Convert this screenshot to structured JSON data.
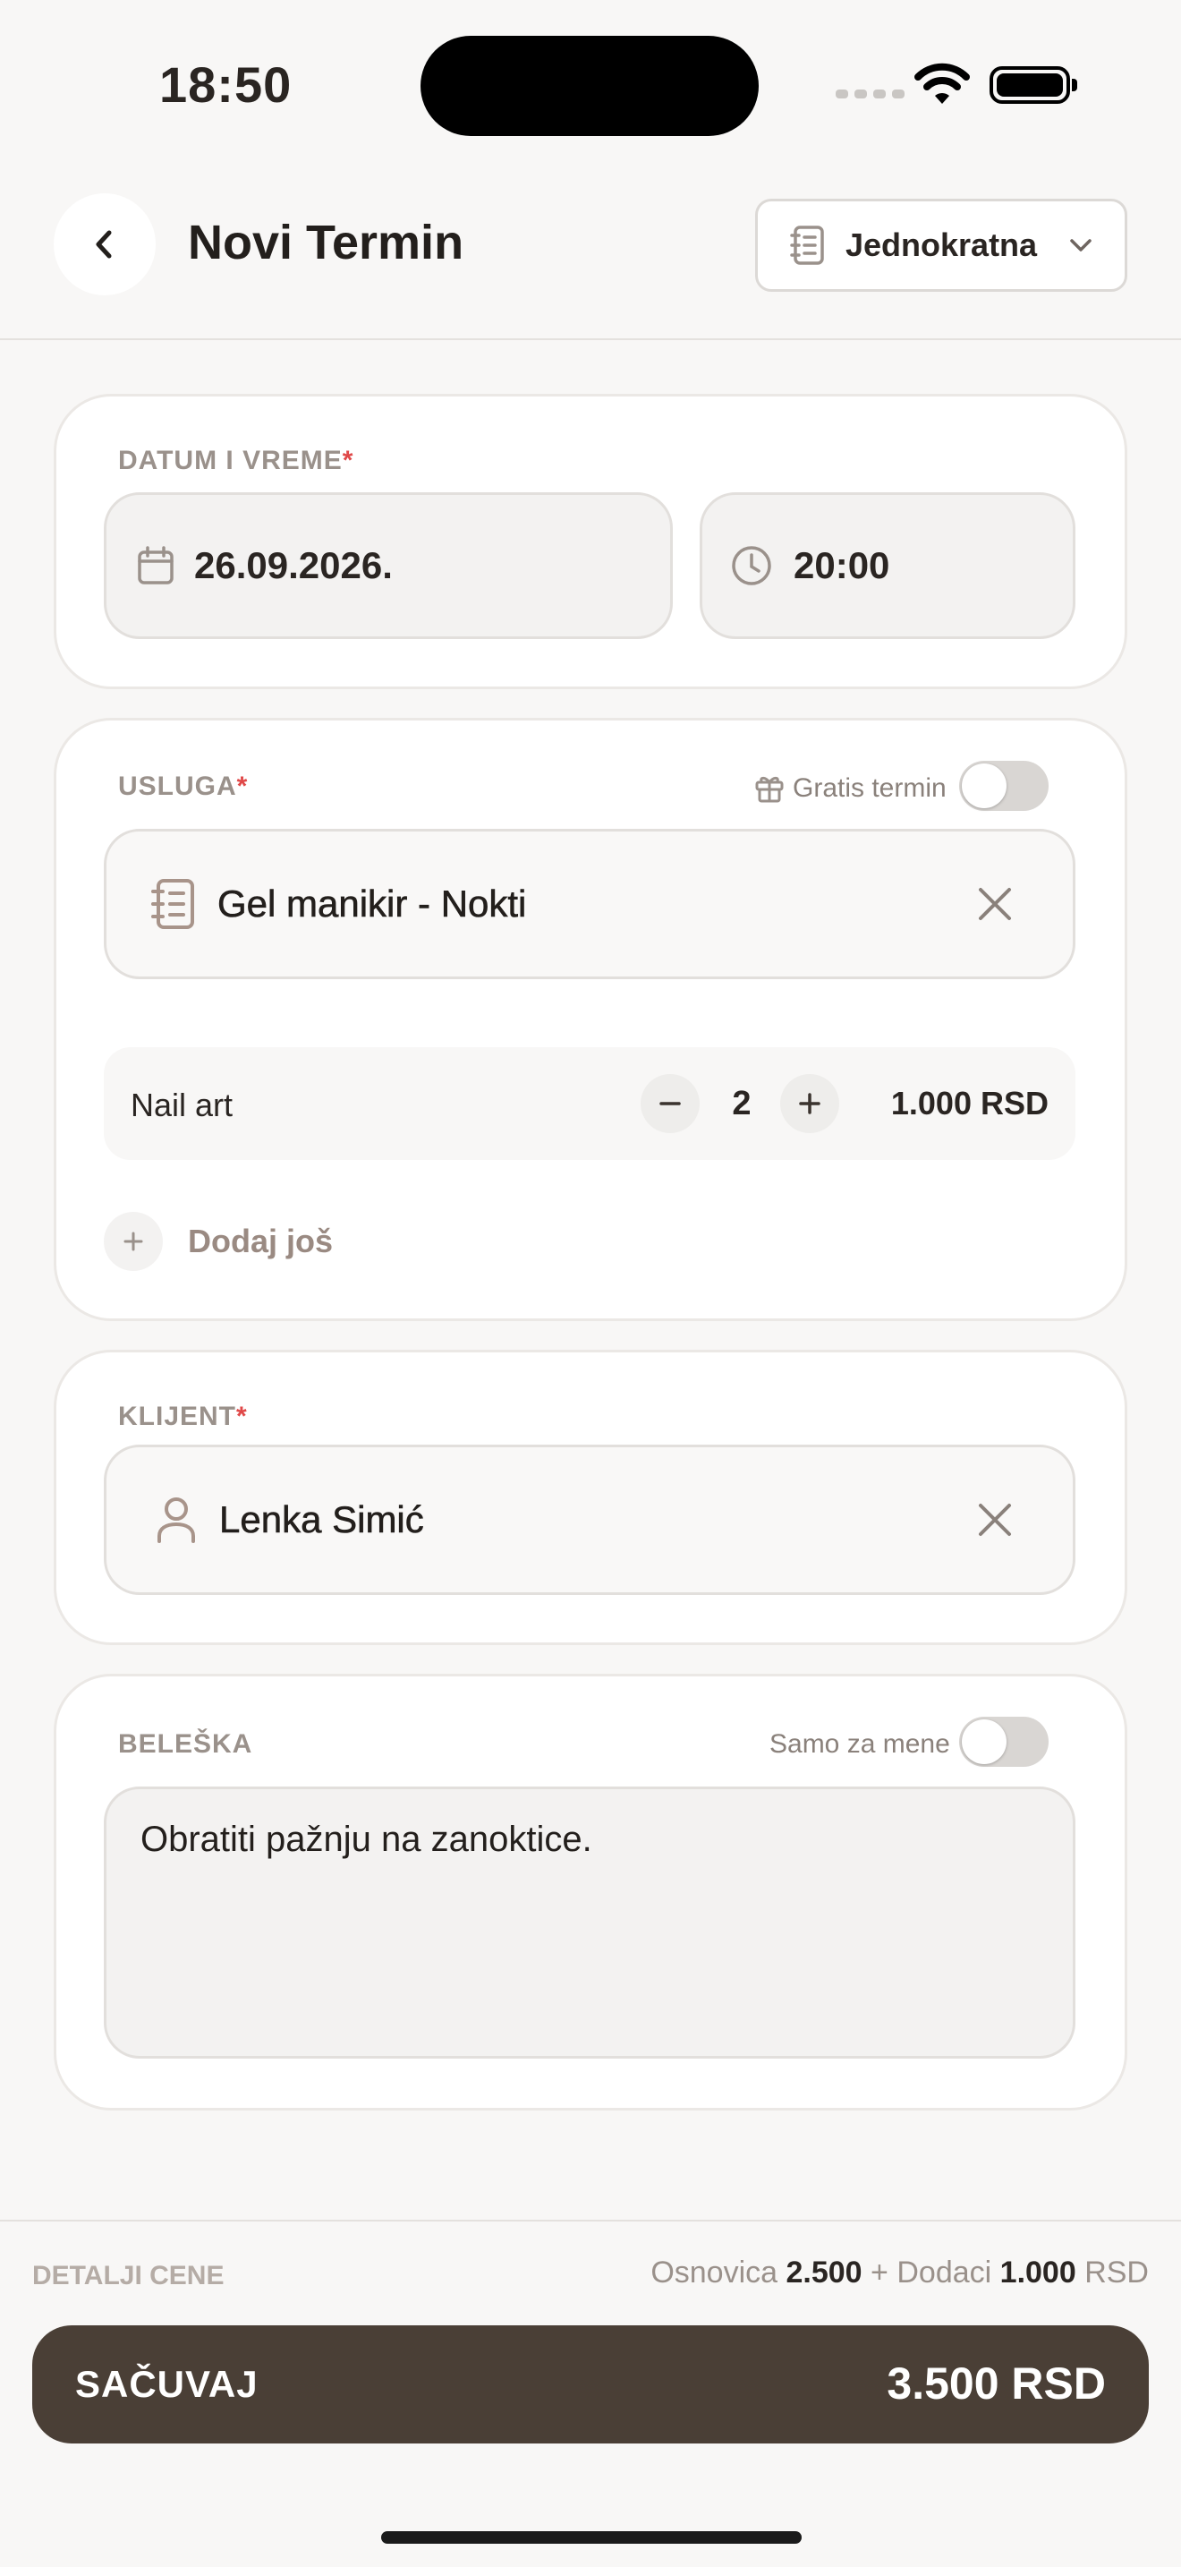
{
  "status_bar": {
    "time": "18:50"
  },
  "header": {
    "title": "Novi Termin",
    "frequency": "Jednokratna"
  },
  "datetime": {
    "label": "DATUM I VREME",
    "required_mark": "*",
    "date": "26.09.2026.",
    "time": "20:00"
  },
  "service": {
    "label": "USLUGA",
    "required_mark": "*",
    "gratis_label": "Gratis termin",
    "gratis_on": false,
    "selected": "Gel manikir - Nokti",
    "addon": {
      "name": "Nail art",
      "quantity": "2",
      "price": "1.000 RSD"
    },
    "add_more": "Dodaj još"
  },
  "client": {
    "label": "KLIJENT",
    "required_mark": "*",
    "name": "Lenka Simić"
  },
  "note": {
    "label": "BELEŠKA",
    "private_label": "Samo za mene",
    "private_on": false,
    "text": "Obratiti pažnju na zanoktice."
  },
  "price_details": {
    "label": "DETALJI CENE",
    "base_label": "Osnovica",
    "base_value": "2.500",
    "plus": "+",
    "addons_label": "Dodaci",
    "addons_value": "1.000",
    "currency": "RSD"
  },
  "save": {
    "label": "SAČUVAJ",
    "total": "3.500 RSD"
  },
  "colors": {
    "accent": "#4a3f36",
    "required": "#e04848",
    "muted": "#9a918b"
  },
  "icons": [
    "back-icon",
    "notebook-icon",
    "chevron-down-icon",
    "calendar-icon",
    "clock-icon",
    "gift-icon",
    "close-icon",
    "minus-icon",
    "plus-icon",
    "user-icon"
  ]
}
